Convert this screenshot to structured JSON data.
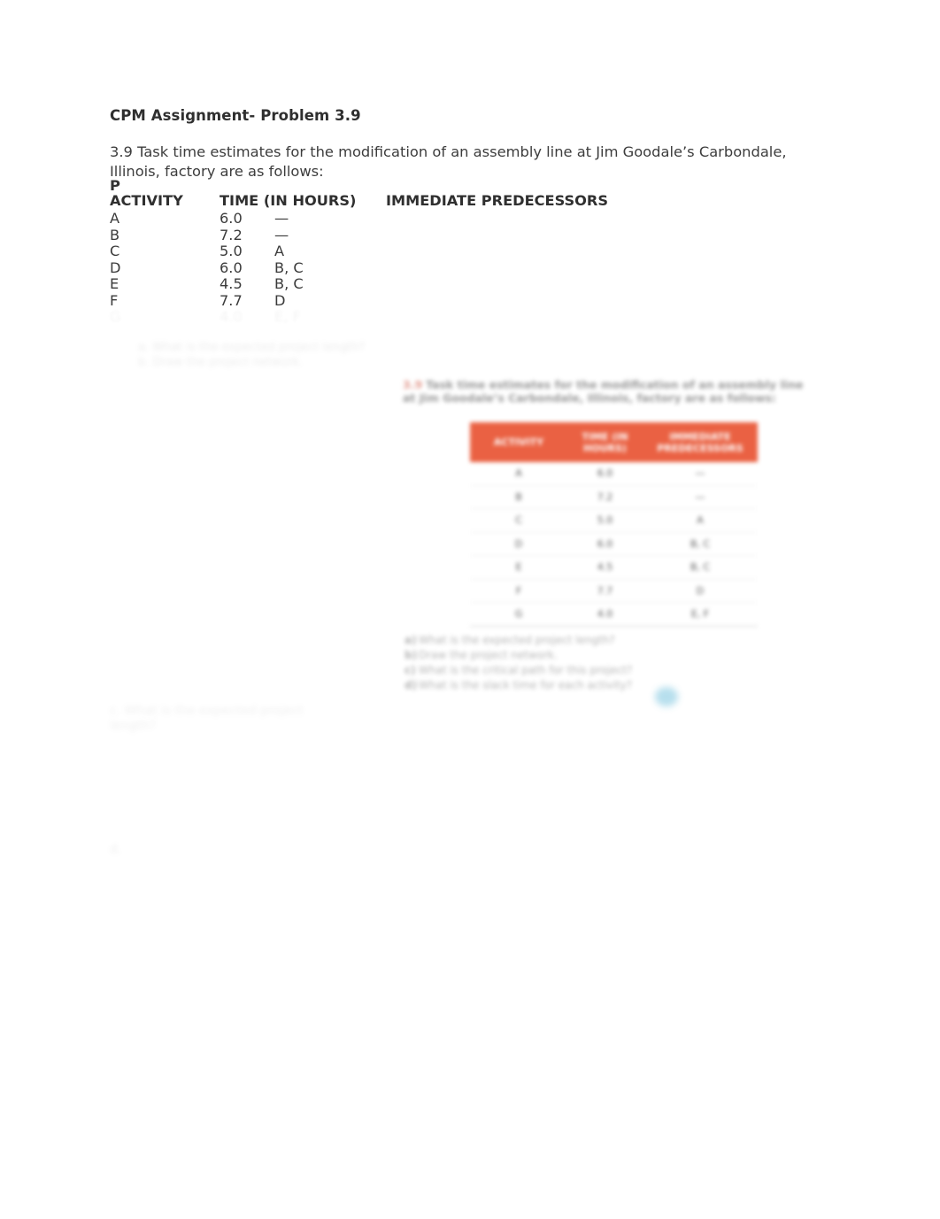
{
  "document": {
    "title": "CPM Assignment- Problem 3.9",
    "problem_intro": "3.9 Task time estimates for the modification of an assembly line at Jim Goodale’s Carbondale, Illinois, factory are as follows:",
    "p_marker": "P"
  },
  "activity_table": {
    "headers": {
      "activity": "ACTIVITY",
      "time": "TIME (IN HOURS)",
      "predecessors": "IMMEDIATE PREDECESSORS"
    },
    "rows": [
      {
        "activity": "A",
        "time": "6.0",
        "predecessors": "—"
      },
      {
        "activity": "B",
        "time": "7.2",
        "predecessors": "—"
      },
      {
        "activity": "C",
        "time": "5.0",
        "predecessors": "A"
      },
      {
        "activity": "D",
        "time": "6.0",
        "predecessors": "B, C"
      },
      {
        "activity": "E",
        "time": "4.5",
        "predecessors": "B, C"
      },
      {
        "activity": "F",
        "time": "7.7",
        "predecessors": "D"
      },
      {
        "activity": "G",
        "time": "4.0",
        "predecessors": "E, F"
      }
    ]
  },
  "ghost_text": {
    "sub_note": "a. What is the expected project length?\nb. Draw the project network.",
    "left_mid": "c. What is the expected project length?",
    "left_low": "d."
  },
  "figure": {
    "caption_number": "3.9",
    "caption_text": "Task time estimates for the modification of an assembly line at Jim Goodale’s Carbondale, Illinois, factory are as follows:",
    "table": {
      "headers": [
        "ACTIVITY",
        "TIME (IN HOURS)",
        "IMMEDIATE PREDECESSORS"
      ],
      "rows": [
        [
          "A",
          "6.0",
          "—"
        ],
        [
          "B",
          "7.2",
          "—"
        ],
        [
          "C",
          "5.0",
          "A"
        ],
        [
          "D",
          "6.0",
          "B, C"
        ],
        [
          "E",
          "4.5",
          "B, C"
        ],
        [
          "F",
          "7.7",
          "D"
        ],
        [
          "G",
          "4.0",
          "E, F"
        ]
      ]
    },
    "questions": [
      {
        "mark": "a)",
        "text": "What is the expected project length?"
      },
      {
        "mark": "b)",
        "text": "Draw the project network."
      },
      {
        "mark": "c)",
        "text": "What is the critical path for this project?"
      },
      {
        "mark": "d)",
        "text": "What is the slack time for each activity?"
      }
    ],
    "accent_color": "#e8512f",
    "blue_mark_color": "#5fb8d8"
  }
}
